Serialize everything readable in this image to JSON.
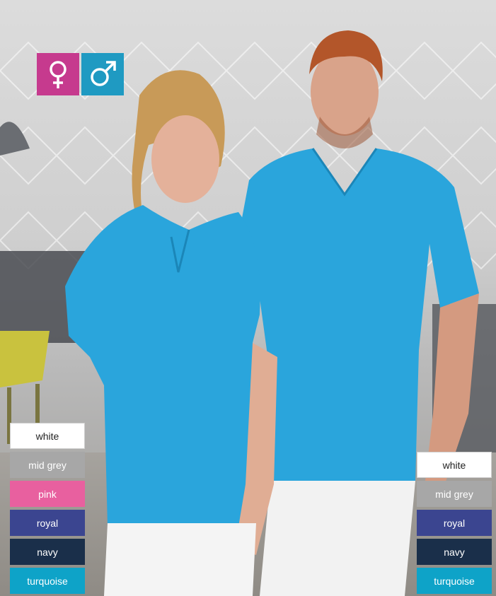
{
  "gender_icons": [
    {
      "icon": "female-symbol-icon",
      "color": "#c63a8e"
    },
    {
      "icon": "male-symbol-icon",
      "color": "#1f9ac2"
    }
  ],
  "women_colors": [
    {
      "label": "white",
      "color": "#ffffff"
    },
    {
      "label": "mid grey",
      "color": "#a7a7a7"
    },
    {
      "label": "pink",
      "color": "#e8609f"
    },
    {
      "label": "royal",
      "color": "#3b4590"
    },
    {
      "label": "navy",
      "color": "#1a2f4a"
    },
    {
      "label": "turquoise",
      "color": "#0ea3c8"
    }
  ],
  "men_colors": [
    {
      "label": "white",
      "color": "#ffffff"
    },
    {
      "label": "mid grey",
      "color": "#a7a7a7"
    },
    {
      "label": "royal",
      "color": "#3b4590"
    },
    {
      "label": "navy",
      "color": "#1a2f4a"
    },
    {
      "label": "turquoise",
      "color": "#0ea3c8"
    }
  ],
  "scrub_color": "#2aa5dc"
}
